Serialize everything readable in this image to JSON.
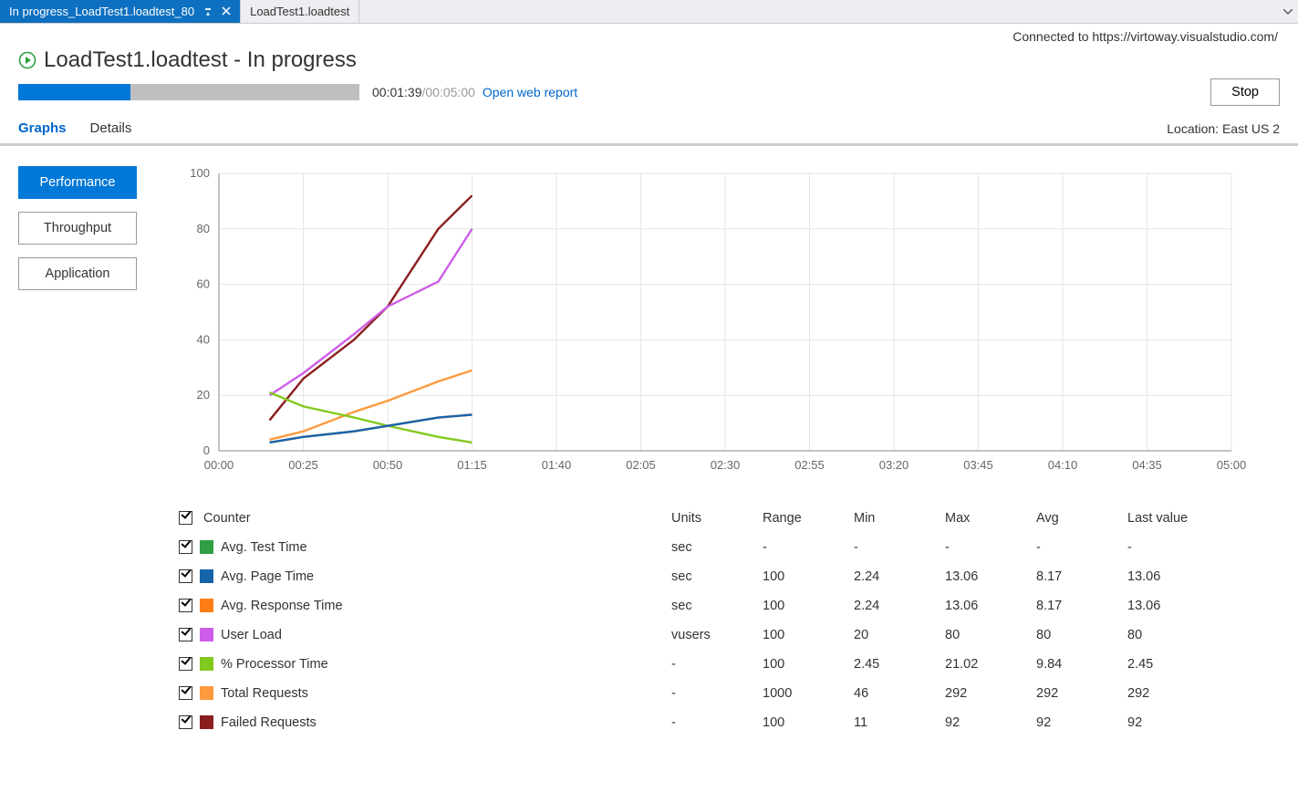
{
  "tabs": {
    "active_label": "In progress_LoadTest1.loadtest_80",
    "inactive_label": "LoadTest1.loadtest"
  },
  "connection_text": "Connected to https://virtoway.visualstudio.com/",
  "title": "LoadTest1.loadtest - In progress",
  "progress": {
    "elapsed": "00:01:39",
    "total": "/00:05:00",
    "link": "Open web report",
    "fill_pct": 33
  },
  "stop_label": "Stop",
  "viewtabs": {
    "graphs": "Graphs",
    "details": "Details"
  },
  "location": "Location: East US 2",
  "sidebar": {
    "performance": "Performance",
    "throughput": "Throughput",
    "application": "Application"
  },
  "colors": {
    "avg_test_time": "#2f9e44",
    "avg_page_time": "#1864ab",
    "avg_response_time": "#fd7e14",
    "user_load": "#cc5de8",
    "processor_time": "#82c91e",
    "total_requests": "#fd9a3e",
    "failed_requests": "#8b1e1e"
  },
  "chart_data": {
    "type": "line",
    "xlim": [
      "00:00",
      "05:00"
    ],
    "ylim": [
      0,
      100
    ],
    "x_ticks": [
      "00:00",
      "00:25",
      "00:50",
      "01:15",
      "01:40",
      "02:05",
      "02:30",
      "02:55",
      "03:20",
      "03:45",
      "04:10",
      "04:35",
      "05:00"
    ],
    "y_ticks": [
      0,
      20,
      40,
      60,
      80,
      100
    ],
    "x_values_sec": [
      15,
      25,
      40,
      50,
      65,
      75
    ],
    "series": [
      {
        "name": "Failed Requests",
        "color": "#8b1e1e",
        "values": [
          11,
          26,
          40,
          52,
          80,
          92
        ]
      },
      {
        "name": "User Load",
        "color": "#cc5de8",
        "values": [
          20,
          28,
          42,
          52,
          61,
          80
        ]
      },
      {
        "name": "Total Requests",
        "color": "#fd9a3e",
        "values": [
          4,
          7,
          14,
          18,
          25,
          29
        ]
      },
      {
        "name": "% Processor Time",
        "color": "#82c91e",
        "values": [
          21,
          16,
          12,
          9,
          5,
          3
        ]
      },
      {
        "name": "Avg. Response Time",
        "color": "#fd7e14",
        "values": [
          3,
          5,
          7,
          9,
          12,
          13
        ]
      },
      {
        "name": "Avg. Page Time",
        "color": "#1864ab",
        "values": [
          3,
          5,
          7,
          9,
          12,
          13
        ]
      }
    ]
  },
  "counter_headers": {
    "counter": "Counter",
    "units": "Units",
    "range": "Range",
    "min": "Min",
    "max": "Max",
    "avg": "Avg",
    "last": "Last value"
  },
  "counters": [
    {
      "color_key": "avg_test_time",
      "label": "Avg. Test Time",
      "units": "sec",
      "range": "-",
      "min": "-",
      "max": "-",
      "avg": "-",
      "last": "-"
    },
    {
      "color_key": "avg_page_time",
      "label": "Avg. Page Time",
      "units": "sec",
      "range": "100",
      "min": "2.24",
      "max": "13.06",
      "avg": "8.17",
      "last": "13.06"
    },
    {
      "color_key": "avg_response_time",
      "label": "Avg. Response Time",
      "units": "sec",
      "range": "100",
      "min": "2.24",
      "max": "13.06",
      "avg": "8.17",
      "last": "13.06"
    },
    {
      "color_key": "user_load",
      "label": "User Load",
      "units": "vusers",
      "range": "100",
      "min": "20",
      "max": "80",
      "avg": "80",
      "last": "80"
    },
    {
      "color_key": "processor_time",
      "label": "% Processor Time",
      "units": "-",
      "range": "100",
      "min": "2.45",
      "max": "21.02",
      "avg": "9.84",
      "last": "2.45"
    },
    {
      "color_key": "total_requests",
      "label": "Total Requests",
      "units": "-",
      "range": "1000",
      "min": "46",
      "max": "292",
      "avg": "292",
      "last": "292"
    },
    {
      "color_key": "failed_requests",
      "label": "Failed Requests",
      "units": "-",
      "range": "100",
      "min": "11",
      "max": "92",
      "avg": "92",
      "last": "92"
    }
  ]
}
